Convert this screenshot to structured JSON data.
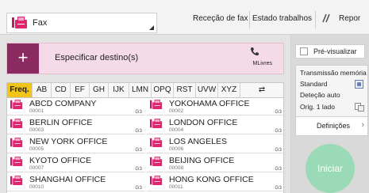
{
  "app": {
    "name": "Fax"
  },
  "top": {
    "rececao": "Receção de fax",
    "estado": "Estado trabalhos",
    "repor": "Repor"
  },
  "destination": {
    "label": "Especificar destino(s)",
    "free": "MLivres"
  },
  "tabs": [
    "Freq.",
    "AB",
    "CD",
    "EF",
    "GH",
    "IJK",
    "LMN",
    "OPQ",
    "RST",
    "UVW",
    "XYZ",
    "⇄"
  ],
  "entries": [
    {
      "name": "ABCD COMPANY",
      "num": "00001",
      "g3": "G3"
    },
    {
      "name": "YOKOHAMA OFFICE",
      "num": "00002",
      "g3": "G3"
    },
    {
      "name": "BERLIN OFFICE",
      "num": "00003",
      "g3": "G3"
    },
    {
      "name": "LONDON OFFICE",
      "num": "00004",
      "g3": "G3"
    },
    {
      "name": "NEW YORK OFFICE",
      "num": "00005",
      "g3": "G3"
    },
    {
      "name": "LOS ANGELES",
      "num": "00006",
      "g3": "G3"
    },
    {
      "name": "KYOTO OFFICE",
      "num": "00007",
      "g3": "G3"
    },
    {
      "name": "BEIJING OFFICE",
      "num": "00008",
      "g3": "G3"
    },
    {
      "name": "SHANGHAI  OFFICE",
      "num": "00010",
      "g3": "G3"
    },
    {
      "name": "HONG KONG OFFICE",
      "num": "00011",
      "g3": "G3"
    }
  ],
  "side": {
    "preview": "Pré-visualizar",
    "transmissao": "Transmissão memória",
    "standard": "Standard",
    "detecao": "Deteção auto",
    "orig": "Orig. 1 lado",
    "definicoes": "Definições",
    "iniciar": "Iniciar"
  },
  "colors": {
    "accent_magenta": "#e0246f",
    "dest_button": "#8a2a60",
    "tab_active": "#f0c419",
    "start_button": "#9bdab6"
  }
}
